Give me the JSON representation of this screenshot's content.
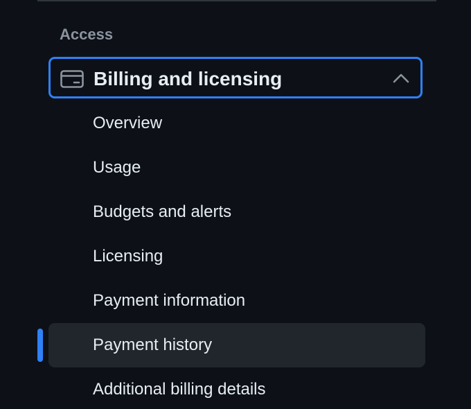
{
  "nav": {
    "section_heading": "Access",
    "group": {
      "title": "Billing and licensing",
      "icon": "credit-card-icon",
      "expanded": true,
      "toggle_icon": "chevron-up-icon"
    },
    "items": [
      {
        "label": "Overview"
      },
      {
        "label": "Usage"
      },
      {
        "label": "Budgets and alerts"
      },
      {
        "label": "Licensing"
      },
      {
        "label": "Payment information"
      },
      {
        "label": "Payment history",
        "active": true
      },
      {
        "label": "Additional billing details"
      }
    ]
  },
  "colors": {
    "background": "#0d1117",
    "focus_border": "#2f81f7",
    "active_bg": "#21262d",
    "active_indicator": "#2f81f7",
    "muted_text": "#8b949e",
    "primary_text": "#e6edf3"
  }
}
